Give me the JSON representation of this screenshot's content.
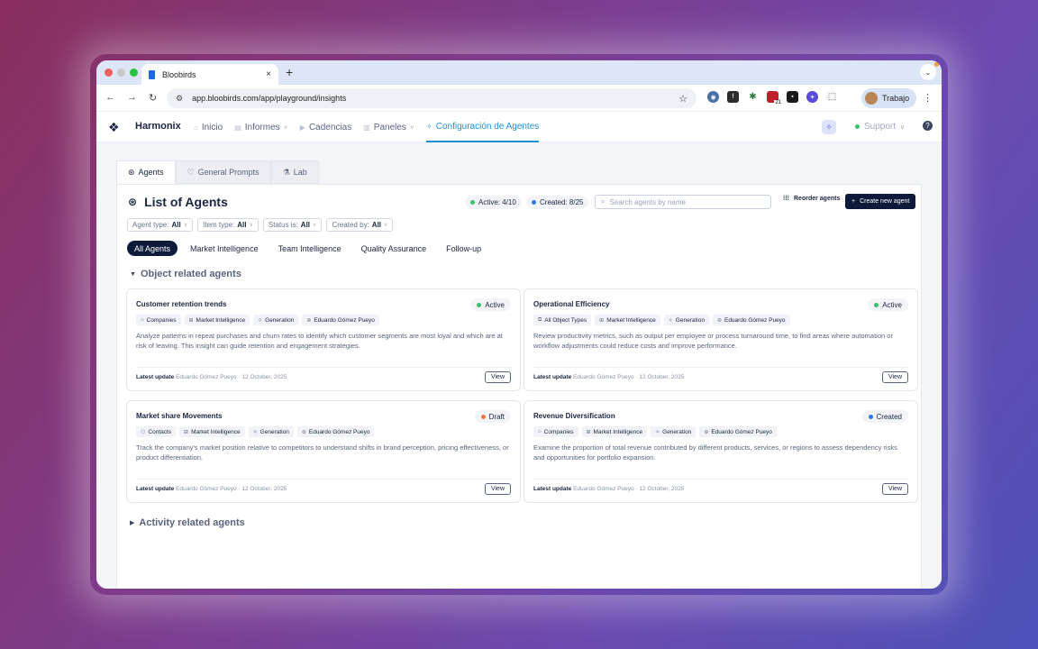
{
  "browser": {
    "tab_title": "Bloobirds",
    "tab_close": "×",
    "new_tab": "+",
    "url": "app.bloobirds.com/app/playground/insights",
    "profile_name": "Trabajo",
    "ext_badge": "21"
  },
  "header": {
    "brand": "Harmonix",
    "nav": [
      {
        "label": "Inicio",
        "icon": "home-icon",
        "dropdown": false,
        "active": false
      },
      {
        "label": "Informes",
        "icon": "report-icon",
        "dropdown": true,
        "active": false
      },
      {
        "label": "Cadencias",
        "icon": "play-icon",
        "dropdown": false,
        "active": false
      },
      {
        "label": "Paneles",
        "icon": "panel-icon",
        "dropdown": true,
        "active": false
      },
      {
        "label": "Configuración de Agentes",
        "icon": "sparkle-icon",
        "dropdown": false,
        "active": true
      }
    ],
    "support_label": "Support"
  },
  "subtabs": [
    {
      "label": "Agents",
      "active": true
    },
    {
      "label": "General Prompts",
      "active": false
    },
    {
      "label": "Lab",
      "active": false
    }
  ],
  "page": {
    "title": "List of Agents",
    "active_stat": "Active: 4/10",
    "created_stat": "Created: 8/25",
    "search_placeholder": "Search agents by name",
    "reorder_label": "Reorder agents",
    "create_label": "Create new agent"
  },
  "filters": [
    {
      "label": "Agent type:",
      "value": "All"
    },
    {
      "label": "Item type:",
      "value": "All"
    },
    {
      "label": "Status is:",
      "value": "All"
    },
    {
      "label": "Created by:",
      "value": "All"
    }
  ],
  "categories": [
    "All Agents",
    "Market Intelligence",
    "Team Intelligence",
    "Quality Assurance",
    "Follow-up"
  ],
  "sections": {
    "object": "Object related agents",
    "activity": "Activity related agents"
  },
  "colors": {
    "active": "#3ac16b",
    "draft": "#f0793a",
    "created": "#2f7be0"
  },
  "cards": [
    {
      "title": "Customer retention trends",
      "status": "Active",
      "status_color": "#3ac16b",
      "tags": [
        "Companies",
        "Market Intelligence",
        "Generation",
        "Eduardo Gómez Pueyo"
      ],
      "description": "Analyze patterns in repeat purchases and churn rates to identify which customer segments are most loyal and which are at risk of leaving. This insight can guide retention and engagement strategies.",
      "update_label": "Latest update",
      "update_text": "Eduardo Gómez Pueyo · 12 October, 2025",
      "view_label": "View"
    },
    {
      "title": "Operational Efficiency",
      "status": "Active",
      "status_color": "#3ac16b",
      "tags": [
        "All Object Types",
        "Market Intelligence",
        "Generation",
        "Eduardo Gómez Pueyo"
      ],
      "description": "Review productivity metrics, such as output per employee or process turnaround time, to find areas where automation or workflow adjustments could reduce costs and improve performance.",
      "update_label": "Latest update",
      "update_text": "Eduardo Gómez Pueyo · 12 October, 2025",
      "view_label": "View"
    },
    {
      "title": "Market share Movements",
      "status": "Draft",
      "status_color": "#f0793a",
      "tags": [
        "Contacts",
        "Market Intelligence",
        "Generation",
        "Eduardo Gómez Pueyo"
      ],
      "description": "Track the company's market position relative to competitors to understand shifts in brand perception, pricing effectiveness, or product differentiation.",
      "update_label": "Latest update",
      "update_text": "Eduardo Gómez Pueyo · 12 October, 2025",
      "view_label": "View"
    },
    {
      "title": "Revenue Diversification",
      "status": "Created",
      "status_color": "#2f7be0",
      "tags": [
        "Companies",
        "Market Intelligence",
        "Generation",
        "Eduardo Gómez Pueyo"
      ],
      "description": "Examine the proportion of total revenue contributed by different products, services, or regions to assess dependency risks and opportunities for portfolio expansion.",
      "update_label": "Latest update",
      "update_text": "Eduardo Gómez Pueyo · 12 October, 2025",
      "view_label": "View"
    }
  ]
}
